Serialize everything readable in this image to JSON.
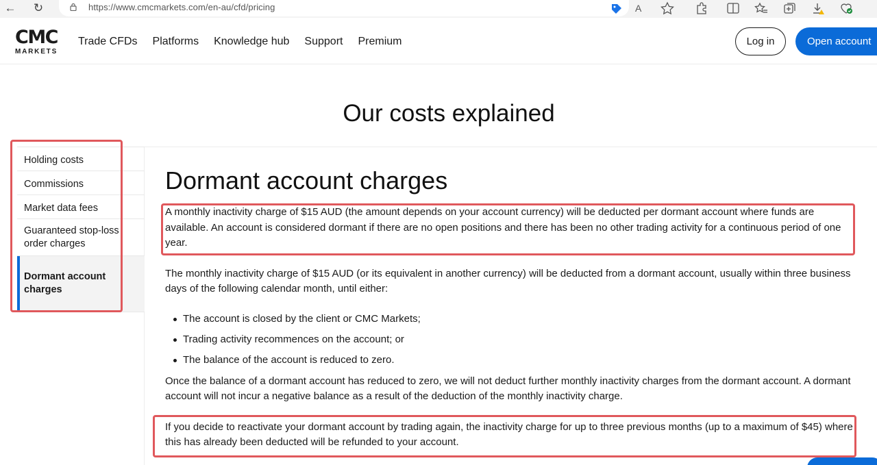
{
  "browser": {
    "url": "https://www.cmcmarkets.com/en-au/cfd/pricing",
    "reader_mode": "A"
  },
  "header": {
    "logo_top": "CMC",
    "logo_bottom": "MARKETS",
    "nav": [
      "Trade CFDs",
      "Platforms",
      "Knowledge hub",
      "Support",
      "Premium"
    ],
    "login_label": "Log in",
    "open_account_label": "Open account"
  },
  "page": {
    "title": "Our costs explained"
  },
  "sidebar": {
    "items": [
      {
        "label": "Holding costs"
      },
      {
        "label": "Commissions"
      },
      {
        "label": "Market data fees"
      },
      {
        "label": "Guaranteed stop-loss order charges"
      },
      {
        "label": "Dormant account charges"
      }
    ],
    "active_index": 4
  },
  "content": {
    "heading": "Dormant account charges",
    "para1": "A monthly inactivity charge of $15 AUD (the amount depends on your account currency) will be deducted per dormant account where funds are available. An account is considered dormant if there are no open positions and there has been no other trading activity for a continuous period of one year.",
    "para2": "The monthly inactivity charge of $15 AUD (or its equivalent in another currency) will be deducted from a dormant account, usually within three business days of the following calendar month, until either:",
    "bullets": [
      "The account is closed by the client or CMC Markets;",
      "Trading activity recommences on the account; or",
      "The balance of the account is reduced to zero."
    ],
    "para3": "Once the balance of a dormant account has reduced to zero, we will not deduct further monthly inactivity charges from the dormant account. A dormant account will not incur a negative balance as a result of the deduction of the monthly inactivity charge.",
    "para4": "If you decide to reactivate your dormant account by trading again, the inactivity charge for up to three previous months (up to a maximum of $45) where this has already been deducted will be refunded to your account."
  },
  "colors": {
    "brand_blue": "#0b6bd8",
    "highlight_red": "#e0585c"
  }
}
